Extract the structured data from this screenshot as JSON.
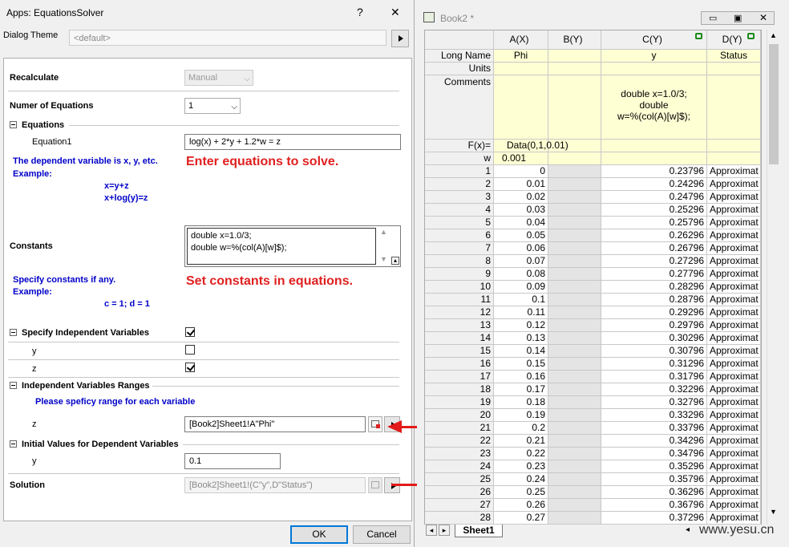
{
  "dialog": {
    "title": "Apps: EquationsSolver",
    "help_glyph": "?",
    "close_glyph": "✕",
    "theme_label": "Dialog Theme",
    "theme_value": "<default>",
    "recalculate_label": "Recalculate",
    "recalculate_value": "Manual",
    "num_eq_label": "Numer of Equations",
    "num_eq_value": "1",
    "equations_section": "Equations",
    "equation1_label": "Equation1",
    "equation1_value": "log(x) + 2*y + 1.2*w = z",
    "help1_line1": "The dependent variable is x, y, etc.",
    "help1_line2": "Example:",
    "help1_ex1": "x=y+z",
    "help1_ex2": "x+log(y)=z",
    "annotation_equations": "Enter equations to solve.",
    "constants_label": "Constants",
    "constants_line1": "double x=1.0/3;",
    "constants_line2": "double w=%(col(A)[w]$);",
    "help2_line1": "Specify constants if any.",
    "help2_line2": "Example:",
    "help2_ex": "c = 1; d = 1",
    "annotation_constants": "Set constants in equations.",
    "indep_section": "Specify Independent Variables",
    "indep_y_label": "y",
    "indep_z_label": "z",
    "indep_all_checked": true,
    "indep_y_checked": false,
    "indep_z_checked": true,
    "ranges_section": "Independent Variables Ranges",
    "ranges_help": "Please speficy range for each variable",
    "range_z_label": "z",
    "range_z_value": "[Book2]Sheet1!A\"Phi\"",
    "init_section": "Initial Values for Dependent Variables",
    "init_y_label": "y",
    "init_y_value": "0.1",
    "solution_label": "Solution",
    "solution_value": "[Book2]Sheet1!(C\"y\",D\"Status\")",
    "ok_label": "OK",
    "cancel_label": "Cancel"
  },
  "book": {
    "title": "Book2 *",
    "columns": [
      "A(X)",
      "B(Y)",
      "C(Y)",
      "D(Y)"
    ],
    "meta_labels": [
      "Long Name",
      "Units",
      "Comments",
      "F(x)=",
      "w"
    ],
    "long_names": [
      "Phi",
      "",
      "y",
      "Status"
    ],
    "comment_c1": "double x=1.0/3;",
    "comment_c2": "double",
    "comment_c3": "w=%(col(A)[w]$);",
    "fx_a": "Data(0,1,0.01)",
    "w_a": "0.001",
    "sheet_tab": "Sheet1",
    "rows": [
      {
        "n": "1",
        "a": "0",
        "c": "0.23796",
        "d": "Approximat"
      },
      {
        "n": "2",
        "a": "0.01",
        "c": "0.24296",
        "d": "Approximat"
      },
      {
        "n": "3",
        "a": "0.02",
        "c": "0.24796",
        "d": "Approximat"
      },
      {
        "n": "4",
        "a": "0.03",
        "c": "0.25296",
        "d": "Approximat"
      },
      {
        "n": "5",
        "a": "0.04",
        "c": "0.25796",
        "d": "Approximat"
      },
      {
        "n": "6",
        "a": "0.05",
        "c": "0.26296",
        "d": "Approximat"
      },
      {
        "n": "7",
        "a": "0.06",
        "c": "0.26796",
        "d": "Approximat"
      },
      {
        "n": "8",
        "a": "0.07",
        "c": "0.27296",
        "d": "Approximat"
      },
      {
        "n": "9",
        "a": "0.08",
        "c": "0.27796",
        "d": "Approximat"
      },
      {
        "n": "10",
        "a": "0.09",
        "c": "0.28296",
        "d": "Approximat"
      },
      {
        "n": "11",
        "a": "0.1",
        "c": "0.28796",
        "d": "Approximat"
      },
      {
        "n": "12",
        "a": "0.11",
        "c": "0.29296",
        "d": "Approximat"
      },
      {
        "n": "13",
        "a": "0.12",
        "c": "0.29796",
        "d": "Approximat"
      },
      {
        "n": "14",
        "a": "0.13",
        "c": "0.30296",
        "d": "Approximat"
      },
      {
        "n": "15",
        "a": "0.14",
        "c": "0.30796",
        "d": "Approximat"
      },
      {
        "n": "16",
        "a": "0.15",
        "c": "0.31296",
        "d": "Approximat"
      },
      {
        "n": "17",
        "a": "0.16",
        "c": "0.31796",
        "d": "Approximat"
      },
      {
        "n": "18",
        "a": "0.17",
        "c": "0.32296",
        "d": "Approximat"
      },
      {
        "n": "19",
        "a": "0.18",
        "c": "0.32796",
        "d": "Approximat"
      },
      {
        "n": "20",
        "a": "0.19",
        "c": "0.33296",
        "d": "Approximat"
      },
      {
        "n": "21",
        "a": "0.2",
        "c": "0.33796",
        "d": "Approximat"
      },
      {
        "n": "22",
        "a": "0.21",
        "c": "0.34296",
        "d": "Approximat"
      },
      {
        "n": "23",
        "a": "0.22",
        "c": "0.34796",
        "d": "Approximat"
      },
      {
        "n": "24",
        "a": "0.23",
        "c": "0.35296",
        "d": "Approximat"
      },
      {
        "n": "25",
        "a": "0.24",
        "c": "0.35796",
        "d": "Approximat"
      },
      {
        "n": "26",
        "a": "0.25",
        "c": "0.36296",
        "d": "Approximat"
      },
      {
        "n": "27",
        "a": "0.26",
        "c": "0.36796",
        "d": "Approximat"
      },
      {
        "n": "28",
        "a": "0.27",
        "c": "0.37296",
        "d": "Approximat"
      }
    ]
  },
  "watermark": "www.yesu.cn",
  "colors": {
    "annotation": "#e02020",
    "help_text": "#0000c8",
    "sheet_yellow": "#ffffd4"
  }
}
